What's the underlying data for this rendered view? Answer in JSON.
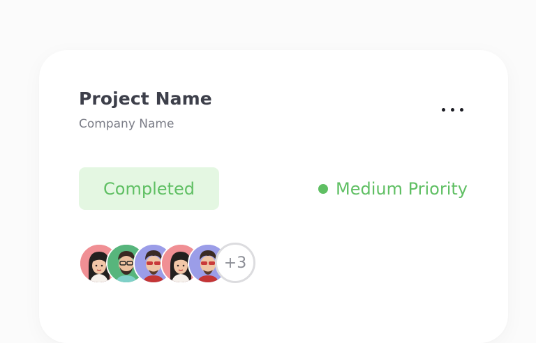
{
  "project": {
    "name": "Project Name",
    "company": "Company Name"
  },
  "status": {
    "label": "Completed",
    "color": "#5fbf63",
    "background": "#e4f7e2"
  },
  "priority": {
    "label": "Medium Priority",
    "color": "#5fbf63"
  },
  "menu": {
    "icon": "more-horizontal-icon"
  },
  "team": {
    "members": [
      {
        "icon": "avatar-woman-icon",
        "bg": "#f08f94"
      },
      {
        "icon": "avatar-man-icon",
        "bg": "#57b57c"
      },
      {
        "icon": "avatar-man-icon",
        "bg": "#9b9de8"
      },
      {
        "icon": "avatar-woman-icon",
        "bg": "#f08f94"
      },
      {
        "icon": "avatar-man-icon",
        "bg": "#9b9de8"
      }
    ],
    "more_label": "+3"
  }
}
